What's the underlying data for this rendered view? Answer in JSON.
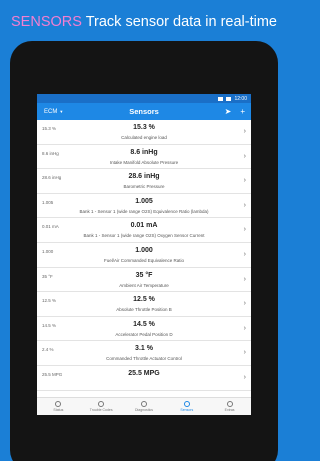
{
  "headline": {
    "strong": "SENSORS",
    "rest": "Track sensor data in real-time"
  },
  "status": {
    "time": "12:00"
  },
  "toolbar": {
    "ecm": "ECM",
    "title": "Sensors",
    "send": "➤",
    "add": "+"
  },
  "sensors": [
    {
      "raw": "15.3 %",
      "value": "15.3 %",
      "label": "Calculated engine load"
    },
    {
      "raw": "8.6 inHg",
      "value": "8.6 inHg",
      "label": "Intake Manifold Absolute Pressure"
    },
    {
      "raw": "28.6 inHg",
      "value": "28.6 inHg",
      "label": "Barometric Pressure"
    },
    {
      "raw": "1.005",
      "value": "1.005",
      "label": "Bank 1 - Sensor 1 (wide range O2S) Equivalence Ratio (lambda)"
    },
    {
      "raw": "0.01 mA",
      "value": "0.01 mA",
      "label": "Bank 1 - Sensor 1 (wide range O2S) Oxygen Sensor Current"
    },
    {
      "raw": "1.000",
      "value": "1.000",
      "label": "Fuel/Air Commanded Equivalence Ratio"
    },
    {
      "raw": "35 °F",
      "value": "35 °F",
      "label": "Ambient Air Temperature"
    },
    {
      "raw": "12.5 %",
      "value": "12.5 %",
      "label": "Absolute Throttle Position B"
    },
    {
      "raw": "14.5 %",
      "value": "14.5 %",
      "label": "Accelerator Pedal Position D"
    },
    {
      "raw": "2.4 %",
      "value": "3.1 %",
      "label": "Commanded Throttle Actuator Control"
    },
    {
      "raw": "25.5 MPG",
      "value": "25.5 MPG",
      "label": ""
    }
  ],
  "nav": [
    {
      "label": "Status",
      "icon": "status-icon"
    },
    {
      "label": "Trouble Codes",
      "icon": "trouble-codes-icon"
    },
    {
      "label": "Diagnostics",
      "icon": "diagnostics-icon"
    },
    {
      "label": "Sensors",
      "icon": "sensors-icon",
      "active": true
    },
    {
      "label": "Extras",
      "icon": "extras-icon"
    }
  ],
  "colors": {
    "background": "#1b7fd6",
    "accent": "#f37fd2",
    "toolbar": "#1e88e5"
  }
}
